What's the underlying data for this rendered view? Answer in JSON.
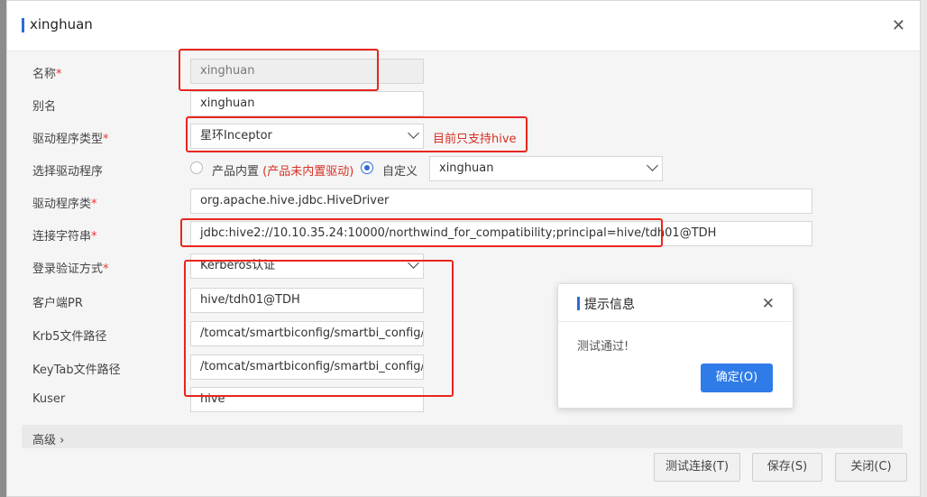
{
  "dialog": {
    "title": "xinghuan"
  },
  "form": {
    "name": {
      "label": "名称",
      "required": "*",
      "value": "xinghuan"
    },
    "alias": {
      "label": "别名",
      "value": "xinghuan"
    },
    "driver_type": {
      "label": "驱动程序类型",
      "required": "*",
      "value": "星环Inceptor",
      "hint": "目前只支持hive"
    },
    "select_driver": {
      "label": "选择驱动程序",
      "option_builtin": "产品内置",
      "builtin_note": "(产品未内置驱动)",
      "option_custom": "自定义",
      "custom_value": "xinghuan"
    },
    "driver_class": {
      "label": "驱动程序类",
      "required": "*",
      "value": "org.apache.hive.jdbc.HiveDriver"
    },
    "conn_string": {
      "label": "连接字符串",
      "required": "*",
      "value": "jdbc:hive2://10.10.35.24:10000/northwind_for_compatibility;principal=hive/tdh01@TDH"
    },
    "auth_method": {
      "label": "登录验证方式",
      "required": "*",
      "value": "Kerberos认证"
    },
    "client_pr": {
      "label": "客户端PR",
      "value": "hive/tdh01@TDH"
    },
    "krb5_path": {
      "label": "Krb5文件路径",
      "value": "/tomcat/smartbiconfig/smartbi_config/xin"
    },
    "keytab_path": {
      "label": "KeyTab文件路径",
      "value": "/tomcat/smartbiconfig/smartbi_config/xin"
    },
    "kuser": {
      "label": "Kuser",
      "value": "hive"
    }
  },
  "advanced": {
    "label": "高级 ›"
  },
  "buttons": {
    "test": "测试连接(T)",
    "save": "保存(S)",
    "close": "关闭(C)"
  },
  "message": {
    "title": "提示信息",
    "text": "测试通过!",
    "ok": "确定(O)"
  },
  "icons": {
    "close": "close-icon",
    "dropdown": "chevron-down-icon"
  },
  "colors": {
    "accent": "#2f6bd8",
    "annotation": "#e8261f",
    "required": "#e33333",
    "primary_button": "#2f7be8"
  }
}
